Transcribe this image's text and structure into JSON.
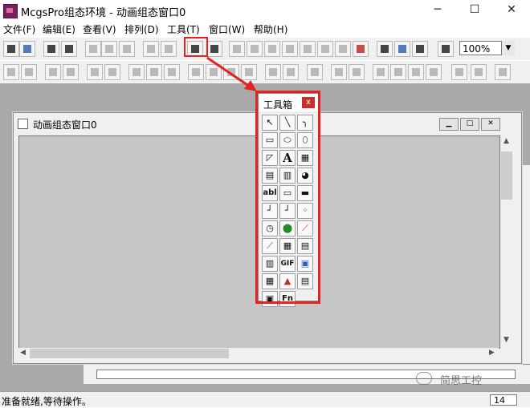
{
  "window": {
    "title": "McgsPro组态环境 - 动画组态窗口0",
    "minimize": "─",
    "maximize": "☐",
    "close": "✕"
  },
  "menubar": {
    "items": [
      "文件(F)",
      "编辑(E)",
      "查看(V)",
      "排列(D)",
      "工具(T)",
      "窗口(W)",
      "帮助(H)"
    ]
  },
  "toolbar": {
    "zoom_value": "100%",
    "zoom_arrow": "▼"
  },
  "child_window": {
    "title": "动画组态窗口0"
  },
  "toolbox": {
    "title": "工具箱",
    "close": "x",
    "tools": [
      "↖",
      "╲",
      "╮",
      "▭",
      "⬭",
      "⬯",
      "◸",
      "A",
      "▦",
      "▤",
      "▥",
      "◕",
      "abl",
      "▭",
      "▬",
      "┘",
      "┘",
      "◦",
      "◷",
      "⬤",
      "⟋",
      "⟋",
      "▦",
      "▤",
      "▥",
      "GIF",
      "▣",
      "▦",
      "▲",
      "▤",
      "▣",
      "Fn"
    ]
  },
  "statusbar": {
    "text": "准备就绪,等待操作。",
    "number": "14"
  },
  "watermark": {
    "text": "简思工控"
  }
}
